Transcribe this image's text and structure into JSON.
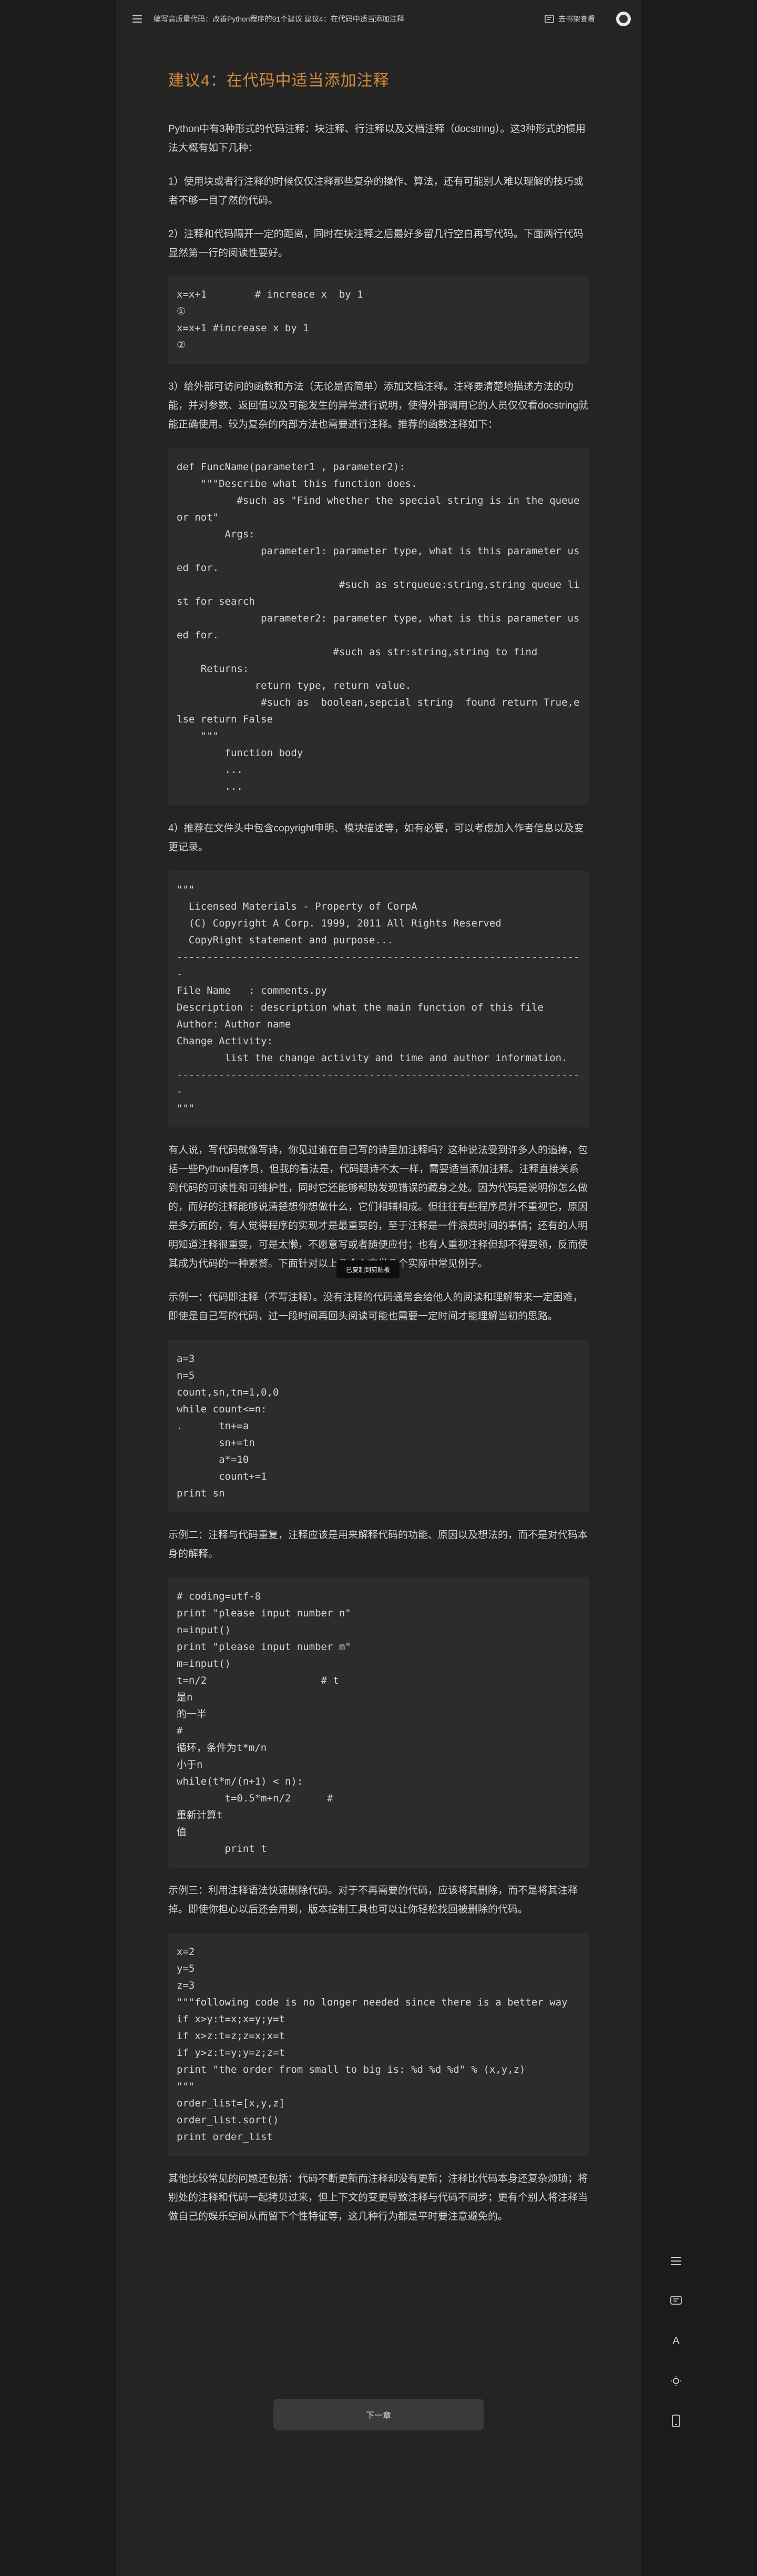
{
  "header": {
    "breadcrumb": "编写高质量代码：改善Python程序的91个建议 建议4：在代码中适当添加注释",
    "read_label": "去书架查看"
  },
  "article": {
    "title": "建议4：在代码中适当添加注释",
    "p1": "Python中有3种形式的代码注释：块注释、行注释以及文档注释（docstring）。这3种形式的惯用法大概有如下几种：",
    "p2": "1）使用块或者行注释的时候仅仅注释那些复杂的操作、算法，还有可能别人难以理解的技巧或者不够一目了然的代码。",
    "p3": "2）注释和代码隔开一定的距离，同时在块注释之后最好多留几行空白再写代码。下面两行代码显然第一行的阅读性要好。",
    "code1": "x=x+1        # increace x  by 1\n①\nx=x+1 #increase x by 1\n②",
    "p4": "3）给外部可访问的函数和方法（无论是否简单）添加文档注释。注释要清楚地描述方法的功能，并对参数、返回值以及可能发生的异常进行说明，使得外部调用它的人员仅仅看docstring就能正确使用。较为复杂的内部方法也需要进行注释。推荐的函数注释如下：",
    "code2": "def FuncName(parameter1 , parameter2):\n    \"\"\"Describe what this function does.\n          #such as \"Find whether the special string is in the queue or not\"\n        Args:\n              parameter1: parameter type, what is this parameter used for.\n                           #such as strqueue:string,string queue list for search\n              parameter2: parameter type, what is this parameter used for.\n                          #such as str:string,string to find\n    Returns:\n             return type, return value.\n              #such as  boolean,sepcial string  found return True,else return False\n    \"\"\"\n        function body\n        ...\n        ...",
    "p5": "4）推荐在文件头中包含copyright申明、模块描述等，如有必要，可以考虑加入作者信息以及变更记录。",
    "code3": "\"\"\"\n  Licensed Materials - Property of CorpA\n  (C) Copyright A Corp. 1999, 2011 All Rights Reserved\n  CopyRight statement and purpose...\n--------------------------------------------------------------------\nFile Name   : comments.py\nDescription : description what the main function of this file\nAuthor: Author name\nChange Activity:\n        list the change activity and time and author information.\n--------------------------------------------------------------------\n\"\"\"",
    "p6": "有人说，写代码就像写诗，你见过谁在自己写的诗里加注释吗？这种说法受到许多人的追捧，包括一些Python程序员，但我的看法是，代码跟诗不太一样，需要适当添加注释。注释直接关系到代码的可读性和可维护性，同时它还能够帮助发现错误的藏身之处。因为代码是说明你怎么做的，而好的注释能够说清楚想你想做什么，它们相辅相成。但往往有些程序员并不重视它，原因是多方面的，有人觉得程序的实现才是最重要的，至于注释是一件浪费时间的事情；还有的人明明知道注释很重要，可是太懒，不愿意写或者随便应付；也有人重视注释但却不得要领，反而使其成为代码的一种累赘。下面针对以上几个心态举几个实际中常见例子。",
    "p7": "示例一：代码即注释（不写注释）。没有注释的代码通常会给他人的阅读和理解带来一定困难，即使是自己写的代码，过一段时间再回头阅读可能也需要一定时间才能理解当初的思路。",
    "code4": "a=3\nn=5\ncount,sn,tn=1,0,0\nwhile count<=n:\n.      tn+=a\n       sn+=tn\n       a*=10\n       count+=1\nprint sn",
    "p8": "示例二：注释与代码重复，注释应该是用来解释代码的功能、原因以及想法的，而不是对代码本身的解释。",
    "code5": "# coding=utf-8\nprint \"please input number n\"\nn=input()\nprint \"please input number m\"\nm=input()\nt=n/2                   # t\n是n\n的一半\n#\n循环，条件为t*m/n\n小于n\nwhile(t*m/(n+1) < n):\n        t=0.5*m+n/2      #\n重新计算t\n值\n        print t",
    "p9": "示例三：利用注释语法快速删除代码。对于不再需要的代码，应该将其删除，而不是将其注释掉。即使你担心以后还会用到，版本控制工具也可以让你轻松找回被删除的代码。",
    "code6": "x=2\ny=5\nz=3\n\"\"\"following code is no longer needed since there is a better way\nif x>y:t=x;x=y;y=t\nif x>z:t=z;z=x;x=t\nif y>z:t=y;y=z;z=t\nprint \"the order from small to big is: %d %d %d\" % (x,y,z)\n\"\"\"\norder_list=[x,y,z]\norder_list.sort()\nprint order_list",
    "p10": "其他比较常见的问题还包括：代码不断更新而注释却没有更新；注释比代码本身还复杂烦琐；将别处的注释和代码一起拷贝过来，但上下文的变更导致注释与代码不同步；更有个别人将注释当做自己的娱乐空间从而留下个性特征等，这几种行为都是平时要注意避免的。"
  },
  "toast": "已复制到剪贴板",
  "next_button": "下一章",
  "tools": {
    "font_label": "A"
  }
}
